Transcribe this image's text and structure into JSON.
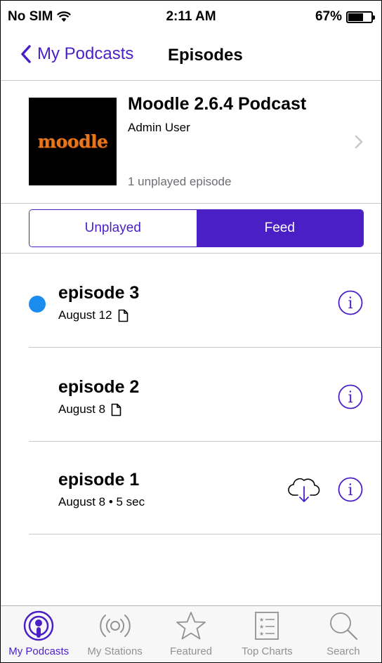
{
  "status_bar": {
    "carrier": "No SIM",
    "time": "2:11 AM",
    "battery_percent": "67%",
    "battery_level": 0.67
  },
  "nav": {
    "back_label": "My Podcasts",
    "title": "Episodes"
  },
  "podcast": {
    "title": "Moodle 2.6.4 Podcast",
    "author": "Admin User",
    "unplayed_count": "1 unplayed episode",
    "artwork_text": "moodle"
  },
  "segments": {
    "unplayed": "Unplayed",
    "feed": "Feed",
    "selected": "feed"
  },
  "episodes": [
    {
      "title": "episode 3",
      "date": "August 12",
      "unplayed": true,
      "has_doc": true,
      "downloadable": false
    },
    {
      "title": "episode 2",
      "date": "August 8",
      "unplayed": false,
      "has_doc": true,
      "downloadable": false
    },
    {
      "title": "episode 1",
      "date": "August 8 • 5 sec",
      "unplayed": false,
      "has_doc": false,
      "downloadable": true
    }
  ],
  "tabs": [
    {
      "label": "My Podcasts",
      "icon": "podcast-icon",
      "active": true
    },
    {
      "label": "My Stations",
      "icon": "broadcast-icon",
      "active": false
    },
    {
      "label": "Featured",
      "icon": "star-icon",
      "active": false
    },
    {
      "label": "Top Charts",
      "icon": "list-icon",
      "active": false
    },
    {
      "label": "Search",
      "icon": "search-icon",
      "active": false
    }
  ],
  "colors": {
    "accent": "#4a1fc6",
    "unplayed_dot": "#1a8cf0",
    "tab_inactive": "#929292"
  }
}
